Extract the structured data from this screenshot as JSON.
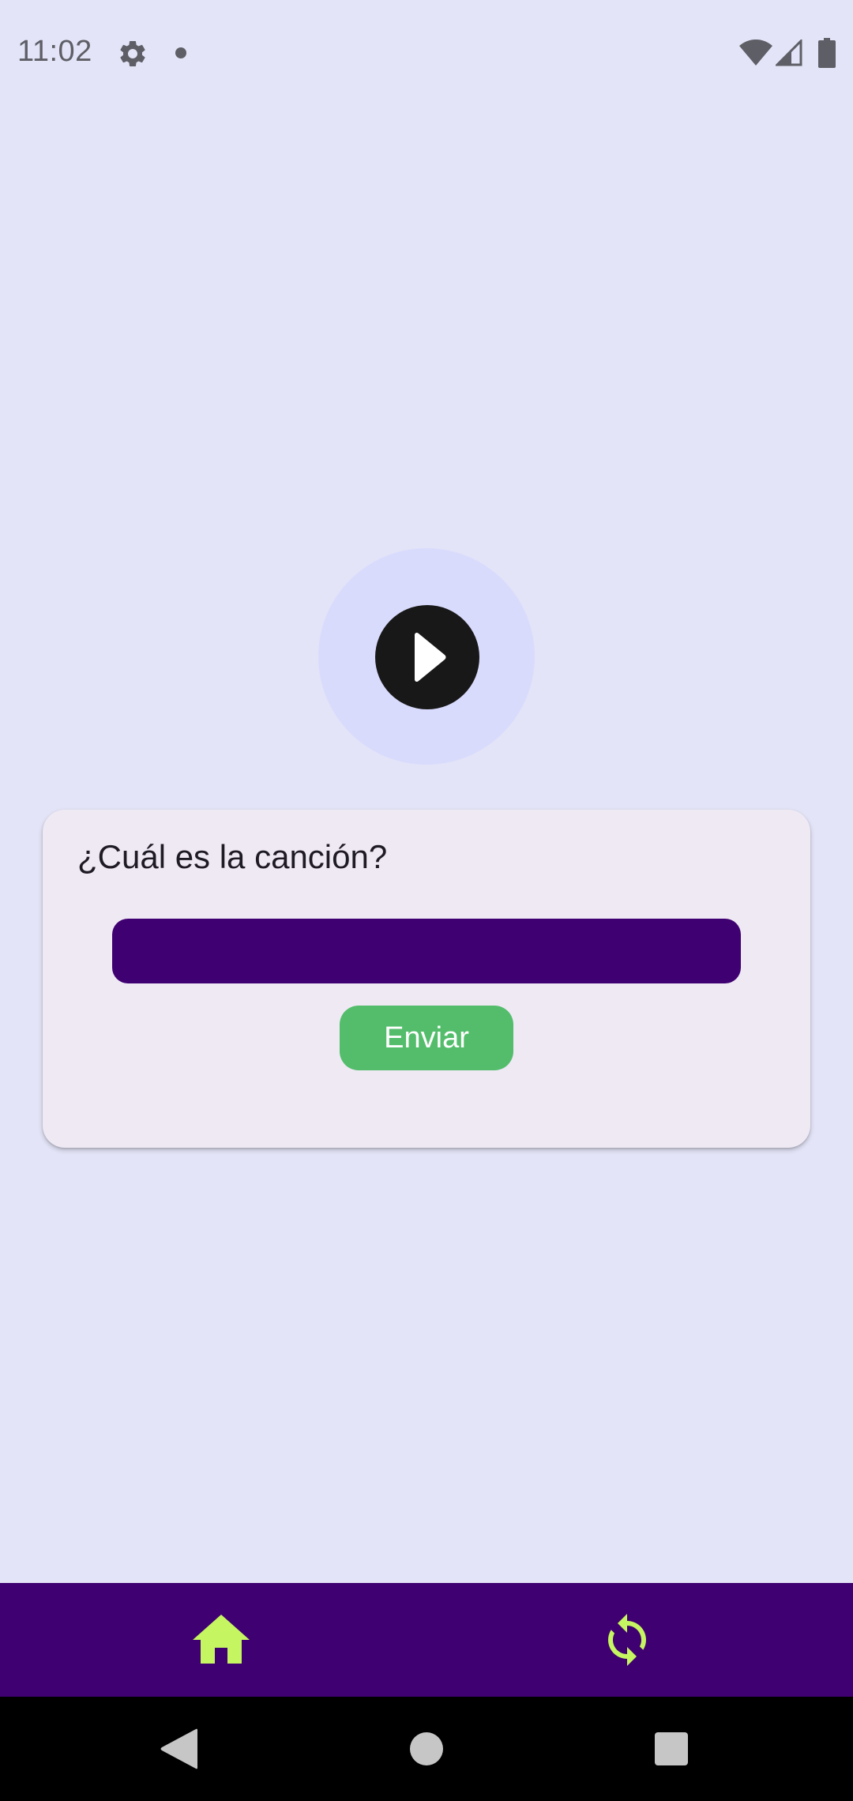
{
  "status_bar": {
    "time": "11:02",
    "icons": [
      "gear-icon",
      "notification-dot-icon",
      "wifi-icon",
      "cell-signal-icon",
      "battery-icon"
    ],
    "icon_color": "#5e5e66"
  },
  "player": {
    "icon": "play-icon",
    "halo_color": "#d9dbfd",
    "button_color": "#181818"
  },
  "quiz_card": {
    "question": "¿Cuál es la canción?",
    "answer_value": "",
    "answer_placeholder": "",
    "submit_label": "Enviar"
  },
  "bottom_nav": {
    "items": [
      {
        "icon": "home-icon",
        "active": true
      },
      {
        "icon": "refresh-icon",
        "active": false
      }
    ],
    "background": "#3f0071",
    "icon_color": "#c6f562"
  },
  "system_nav": {
    "icons": [
      "back-icon",
      "home-circle-icon",
      "recents-icon"
    ]
  },
  "colors": {
    "background": "#e3e4f7",
    "card": "#efe9f4",
    "input": "#3f0071",
    "submit": "#53bd6b"
  }
}
